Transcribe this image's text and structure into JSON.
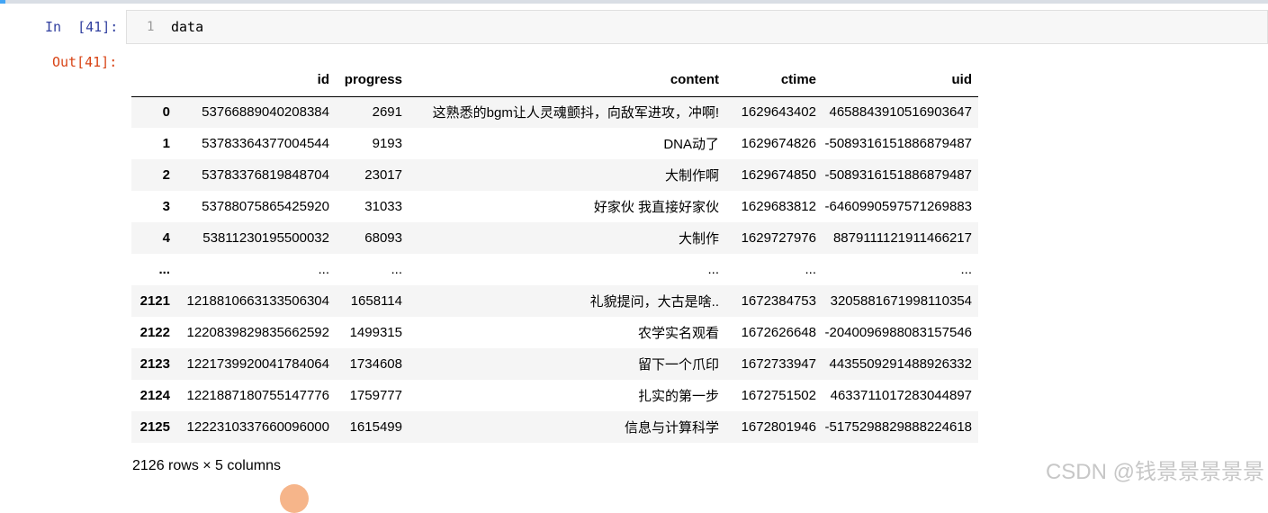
{
  "notebook": {
    "in_prompt": "In  [41]:",
    "out_prompt": "Out[41]:",
    "line_number": "1",
    "code": "data"
  },
  "dataframe": {
    "columns": [
      "",
      "id",
      "progress",
      "content",
      "ctime",
      "uid"
    ],
    "rows": [
      [
        "0",
        "53766889040208384",
        "2691",
        "这熟悉的bgm让人灵魂颤抖，向敌军进攻，冲啊!",
        "1629643402",
        "4658843910516903647"
      ],
      [
        "1",
        "53783364377004544",
        "9193",
        "DNA动了",
        "1629674826",
        "-5089316151886879487"
      ],
      [
        "2",
        "53783376819848704",
        "23017",
        "大制作啊",
        "1629674850",
        "-5089316151886879487"
      ],
      [
        "3",
        "53788075865425920",
        "31033",
        "好家伙 我直接好家伙",
        "1629683812",
        "-6460990597571269883"
      ],
      [
        "4",
        "53811230195500032",
        "68093",
        "大制作",
        "1629727976",
        "8879111121911466217"
      ],
      [
        "...",
        "...",
        "...",
        "...",
        "...",
        "..."
      ],
      [
        "2121",
        "1218810663133506304",
        "1658114",
        "礼貌提问，大古是啥..",
        "1672384753",
        "3205881671998110354"
      ],
      [
        "2122",
        "1220839829835662592",
        "1499315",
        "农学实名观看",
        "1672626648",
        "-2040096988083157546"
      ],
      [
        "2123",
        "1221739920041784064",
        "1734608",
        "留下一个爪印",
        "1672733947",
        "4435509291488926332"
      ],
      [
        "2124",
        "1221887180755147776",
        "1759777",
        "扎实的第一步",
        "1672751502",
        "4633711017283044897"
      ],
      [
        "2125",
        "1222310337660096000",
        "1615499",
        "信息与计算科学",
        "1672801946",
        "-5175298829888224618"
      ]
    ],
    "shape_text": "2126 rows × 5 columns"
  },
  "watermark": "CSDN @钱景景景景景",
  "colors": {
    "in_prompt": "#303f9f",
    "out_prompt": "#d84315",
    "stripe": "#f5f5f5",
    "cell_selected": "#42a5f5"
  }
}
